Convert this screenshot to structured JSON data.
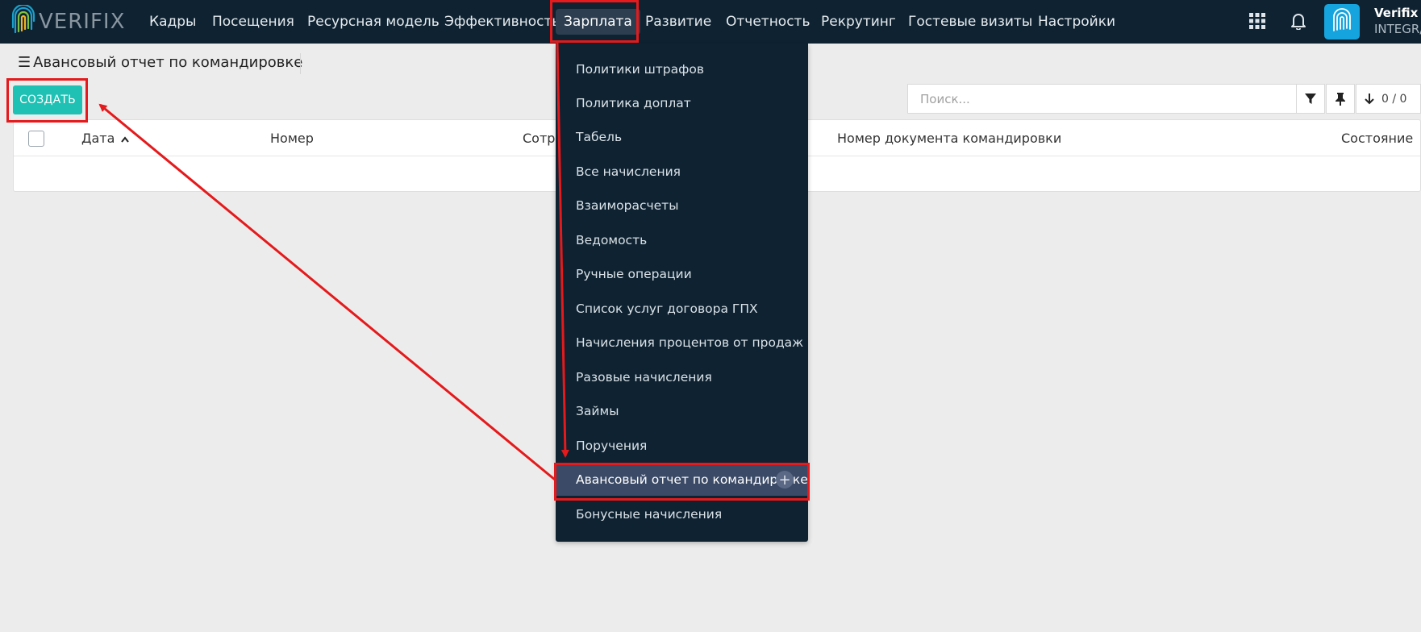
{
  "navbar": {
    "logo_text": "VERIFIX",
    "items": [
      {
        "label": "Кадры"
      },
      {
        "label": "Посещения"
      },
      {
        "label": "Ресурсная модель"
      },
      {
        "label": "Эффективность"
      },
      {
        "label": "Зарплата"
      },
      {
        "label": "Развитие"
      },
      {
        "label": "Отчетность"
      },
      {
        "label": "Рекрутинг"
      },
      {
        "label": "Гостевые визиты"
      },
      {
        "label": "Настройки"
      }
    ],
    "apps_icon": "grid-icon",
    "notifications_icon": "bell-icon",
    "user": {
      "name": "Verifix",
      "company": "INTEGR/"
    }
  },
  "page": {
    "title": "Авансовый отчет по командировке",
    "menu_icon": "hamburger-icon"
  },
  "toolbar": {
    "create_label": "СОЗДАТЬ",
    "search_placeholder": "Поиск...",
    "pager_text": "0 / 0",
    "filter_icon": "filter-icon",
    "pin_icon": "pin-icon",
    "sort_icon": "arrow-down-icon"
  },
  "table": {
    "columns": [
      {
        "label": "Дата",
        "sort": "asc"
      },
      {
        "label": "Номер"
      },
      {
        "label": "Сотру"
      },
      {
        "label": "Номер документа командировки"
      },
      {
        "label": "Состояние"
      }
    ]
  },
  "dropdown": {
    "items": [
      {
        "label": "Политики штрафов"
      },
      {
        "label": "Политика доплат"
      },
      {
        "label": "Табель"
      },
      {
        "label": "Все начисления"
      },
      {
        "label": "Взаиморасчеты"
      },
      {
        "label": "Ведомость"
      },
      {
        "label": "Ручные операции"
      },
      {
        "label": "Список услуг договора ГПХ"
      },
      {
        "label": "Начисления процентов от продаж"
      },
      {
        "label": "Разовые начисления"
      },
      {
        "label": "Займы"
      },
      {
        "label": "Поручения"
      },
      {
        "label": "Авансовый отчет по командировке"
      },
      {
        "label": "Бонусные начисления"
      }
    ],
    "add_icon": "plus-icon"
  },
  "annotations": {
    "color": "#e41a1c"
  }
}
